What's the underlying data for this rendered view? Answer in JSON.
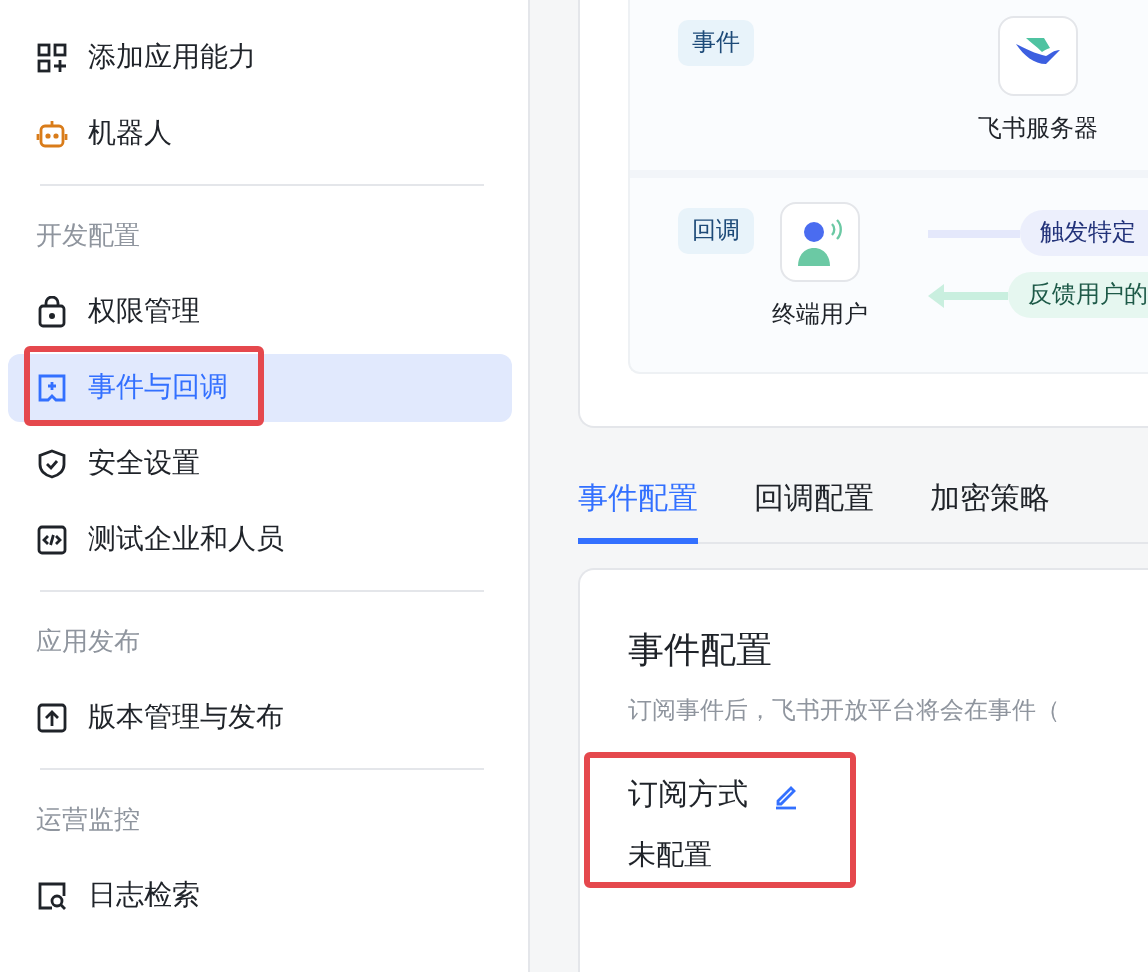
{
  "sidebar": {
    "groups": [
      {
        "items": [
          {
            "label": "添加应用能力",
            "kind": "grid",
            "selected": false,
            "highlighted": false
          },
          {
            "label": "机器人",
            "kind": "robot",
            "selected": false,
            "highlighted": false
          }
        ]
      },
      {
        "heading": "开发配置",
        "items": [
          {
            "label": "权限管理",
            "kind": "lock",
            "selected": false,
            "highlighted": false
          },
          {
            "label": "事件与回调",
            "kind": "event",
            "selected": true,
            "highlighted": true
          },
          {
            "label": "安全设置",
            "kind": "shield",
            "selected": false,
            "highlighted": false
          },
          {
            "label": "测试企业和人员",
            "kind": "code",
            "selected": false,
            "highlighted": false
          }
        ]
      },
      {
        "heading": "应用发布",
        "items": [
          {
            "label": "版本管理与发布",
            "kind": "upload",
            "selected": false,
            "highlighted": false
          }
        ]
      },
      {
        "heading": "运营监控",
        "items": [
          {
            "label": "日志检索",
            "kind": "search",
            "selected": false,
            "highlighted": false
          }
        ]
      }
    ]
  },
  "diagram": {
    "rows": [
      {
        "tag": "事件",
        "node": {
          "label": "飞书服务器",
          "kind": "server"
        },
        "flows": []
      },
      {
        "tag": "回调",
        "node": {
          "label": "终端用户",
          "kind": "user"
        },
        "flows": [
          {
            "label": "触发特定",
            "kind": "forward"
          },
          {
            "label": "反馈用户的",
            "kind": "back"
          }
        ]
      }
    ]
  },
  "tabs": [
    {
      "label": "事件配置",
      "selected": true
    },
    {
      "label": "回调配置",
      "selected": false
    },
    {
      "label": "加密策略",
      "selected": false
    }
  ],
  "section": {
    "title": "事件配置",
    "description": "订阅事件后，飞书开放平台将会在事件（",
    "fields": [
      {
        "label": "订阅方式",
        "value": "未配置",
        "editable": true,
        "highlighted": true
      }
    ]
  }
}
